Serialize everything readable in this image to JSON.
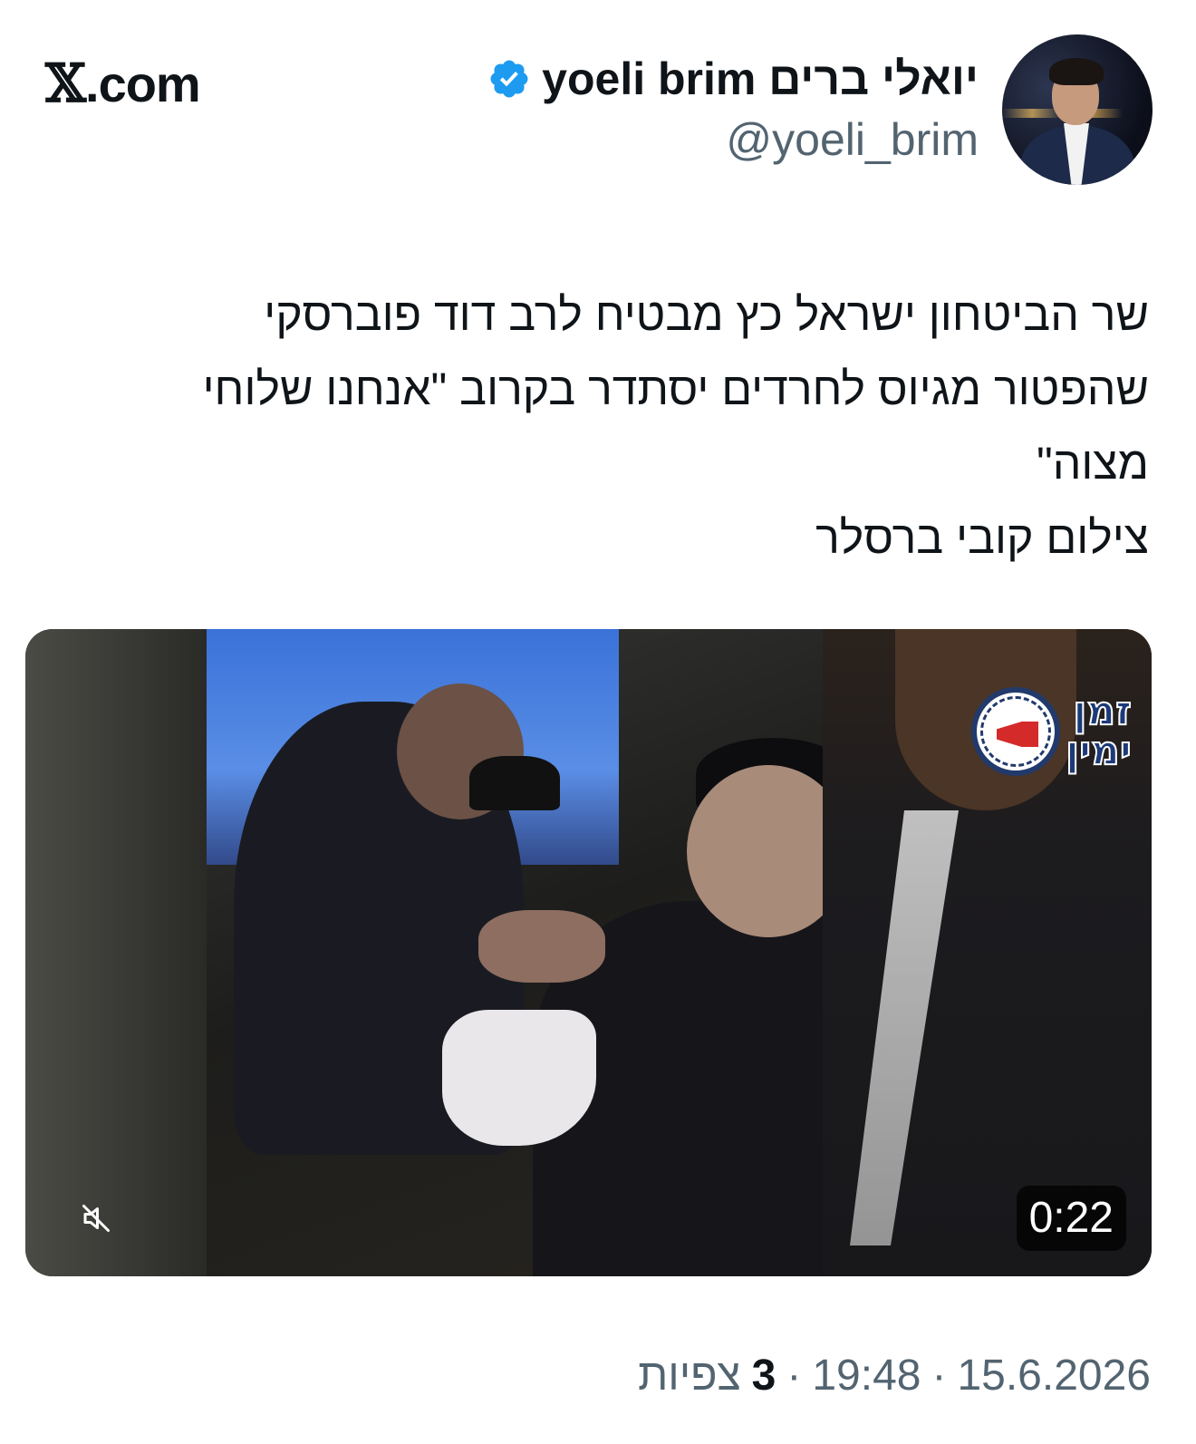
{
  "brand": {
    "logo_text": ".com",
    "logo_glyph": "𝕏"
  },
  "author": {
    "display_name": "יואלי ברים yoeli brim",
    "handle": "@yoeli_brim",
    "verified_icon": "verified-badge-icon",
    "accent_color": "#1d9bf0"
  },
  "tweet": {
    "text": "שר הביטחון ישראל כץ מבטיח לרב דוד פוברסקי\nשהפטור מגיוס לחרדים יסתדר בקרוב \"אנחנו שלוחי\nמצוה\"\nצילום קובי ברסלר"
  },
  "media": {
    "type": "video",
    "duration": "0:22",
    "mute_icon": "mute-icon",
    "watermark_logo": {
      "line1": "זמן",
      "line2": "ימין",
      "icon": "megaphone-clock-icon"
    }
  },
  "meta": {
    "date": "15.6.2026",
    "time": "19:48",
    "separator": "·",
    "views_count": "3",
    "views_label": "צפיות"
  },
  "colors": {
    "text_primary": "#0f1419",
    "text_secondary": "#536471"
  }
}
